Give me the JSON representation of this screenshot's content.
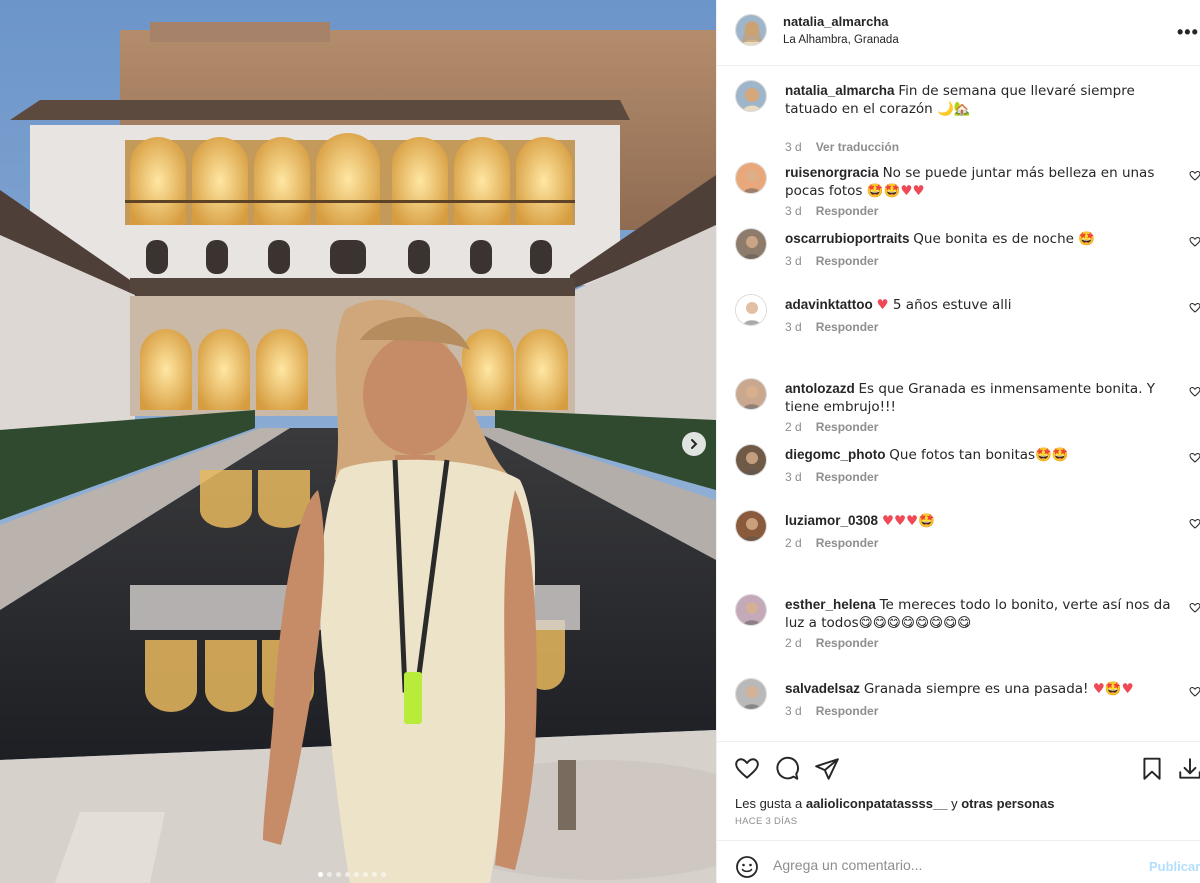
{
  "post": {
    "author": "natalia_almarcha",
    "location": "La Alhambra, Granada",
    "more_icon": "more-horizontal-icon"
  },
  "caption": {
    "user": "natalia_almarcha",
    "text": "Fin de semana que llevaré siempre tatuado en el corazón 🌙🏡",
    "time": "3 d",
    "translate": "Ver traducción"
  },
  "reply_label": "Responder",
  "comments": [
    {
      "user": "ruisenorgracia",
      "text": "No se puede juntar más belleza en unas pocas fotos 🤩🤩❤️❤️",
      "time": "3 d"
    },
    {
      "user": "oscarrubioportraits",
      "text": "Que bonita es de noche 🤩",
      "time": "3 d"
    },
    {
      "user": "adavinktattoo",
      "text": "❤️ 5 años estuve alli",
      "time": "3 d"
    },
    {
      "user": "antolozazd",
      "text": "Es que Granada es inmensamente bonita. Y tiene embrujo!!!",
      "time": "2 d"
    },
    {
      "user": "diegomc_photo",
      "text": "Que fotos tan bonitas🤩🤩",
      "time": "3 d"
    },
    {
      "user": "luziamor_0308",
      "text": "❤️❤️❤️🤩",
      "time": "2 d"
    },
    {
      "user": "esther_helena",
      "text": "Te mereces todo lo bonito, verte así nos da luz a todos😋😋😋😋😋😋😋😋",
      "time": "2 d"
    },
    {
      "user": "salvadelsaz",
      "text": "Granada siempre es una pasada! ❤️🤩❤️",
      "time": "3 d"
    }
  ],
  "likes": {
    "prefix": "Les gusta a",
    "user": "aalioliconpatatassss__",
    "connector": "y",
    "others": "otras personas"
  },
  "time_ago": "HACE 3 DÍAS",
  "add_comment": {
    "placeholder": "Agrega un comentario...",
    "publish": "Publicar"
  },
  "carousel": {
    "dots": 8,
    "active": 1
  },
  "colors": {
    "accent_blue": "#0095f6",
    "publish_disabled": "#b2dffc",
    "heart_red": "#ed4956",
    "meta_gray": "#8e8e8e"
  }
}
